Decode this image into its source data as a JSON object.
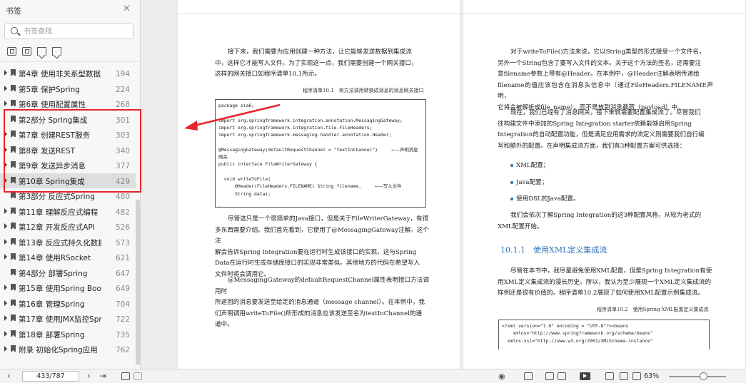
{
  "sidebar": {
    "title": "书签",
    "search_placeholder": "书签查找",
    "items": [
      {
        "label": "第4章 使用非关系型数据",
        "page": "194"
      },
      {
        "label": "第5章 保护Spring",
        "page": "224"
      },
      {
        "label": "第6章 使用配置属性",
        "page": "268"
      },
      {
        "label": "第2部分 Spring集成",
        "page": "301"
      },
      {
        "label": "第7章 创建REST服务",
        "page": "303"
      },
      {
        "label": "第8章 发送REST",
        "page": "340"
      },
      {
        "label": "第9章 发送异步消息",
        "page": "377"
      },
      {
        "label": "第10章 Spring集成",
        "page": "429"
      },
      {
        "label": "第3部分 反应式Spring",
        "page": "480"
      },
      {
        "label": "第11章 理解反应式编程",
        "page": "482"
      },
      {
        "label": "第12章 开发反应式API",
        "page": "526"
      },
      {
        "label": "第13章 反应式持久化数据",
        "page": "573"
      },
      {
        "label": "第14章 使用RSocket",
        "page": "621"
      },
      {
        "label": "第4部分 部署Spring",
        "page": "647"
      },
      {
        "label": "第15章 使用Spring Boot ...",
        "page": "649"
      },
      {
        "label": "第16章 管理Spring",
        "page": "704"
      },
      {
        "label": "第17章 使用JMX监控Spri...",
        "page": "722"
      },
      {
        "label": "第18章 部署Spring",
        "page": "735"
      },
      {
        "label": "附录 初始化Spring应用",
        "page": "762"
      }
    ]
  },
  "doc": {
    "left": {
      "p1": "接下来，我们需要为应用创建一种方法，让它能够发送数据到集成流\n中，这样它才能写入文件。为了实现这一点，我们需要创建一个网关接口，\n这样的网关接口如程序清单10.1所示。",
      "caption": "程序清单10.1　将方法调用转换成消息的消息网关接口",
      "code": "package sia6;\n\nimport org.springframework.integration.annotation.MessagingGateway;\nimport org.springframework.integration.file.FileHeaders;\nimport org.springframework.messaging.handler.annotation.Header;\n\n@MessagingGateway(defaultRequestChannel = \"textInChannel\")     ←——声明消息\n网关\npublic interface FileWriterGateway {\n\n  void writeToFile(\n      @Header(FileHeaders.FILENAME) String filename,     ←——写入文件\n      String data);\n\n}",
      "p2": "尽管这只是一个很简单的Java接口，但是关于FileWriterGateway，有很\n多东西需要介绍。我们首先看到，它使用了@MessagingGateway注解。这个注\n解会告诉Spring Integration要在运行时生成该接口的实现，这与Spring\nData在运行时生成存储库接口的实现非常类似。其他地方的代码在希望写入\n文件时将会调用它。",
      "p3": "@MessagingGateway的defaultRequestChannel属性表明接口方法调用时\n所返回的消息要发送至给定的消息通道（message channel）。在本例中，我\n们声明调用writeToFile()所形成的消息应该发送至名为textInChannel的通\n道中。"
    },
    "right": {
      "p1": "对于writeToFile()方法来说，它以String类型的形式接受一个文件名，\n另外一个String包含了要写入文件的文本。关于这个方法的签名，还需要注\n意filename参数上带有@Header。在本例中，@Header注解表明传递给\nfilename的值应该包含在消息头信息中（通过FileHeaders.FILENAME声明，\n它将会被解析成file_name），而不是放到消息载荷（payload）中。",
      "p2": "现在，我们已经有了消息网关，接下来就需要配置集成流了。尽管我们\n往构建文件中添加的Spring Integration starter依赖能够启用Spring\nIntegration的自动配置功能，但是满足应用需求的流定义则需要我们自行编\n写和额外的配置。在声明集成流方面，我们有3种配置方案可供选择：",
      "bullets": [
        "XML配置；",
        "Java配置；",
        "使用DSL的Java配置。"
      ],
      "p3": "我们会依次了解Spring Integration的这3种配置风格，从较为老式的\nXML配置开始。",
      "section": "10.1.1　使用XML定义集成流",
      "p4": "尽管在本书中，我尽量避免使用XML配置，但是Spring Integration有使\n用XML定义集成流的漫长历史。所以，我认为至少展现一个XML定义集成流的\n样例还是很有价值的。程序清单10.2展现了如何使用XML配置示例集成流。",
      "caption": "程序清单10.2　使用Spring XML配置定义集成流",
      "code": "<?xml version=\"1.0\" encoding = \"UTF-8\"?><beans\n    xmlns=\"http://www.springframework.org/schema/beans\"\n  xmlns:xsi=\"http://www.w3.org/2001/XMLSchema-instance\""
    }
  },
  "bottom": {
    "page_display": "433/787",
    "zoom": "63%"
  },
  "colors": {
    "highlight_box": "#e8232a",
    "section_heading": "#2d6fba"
  }
}
